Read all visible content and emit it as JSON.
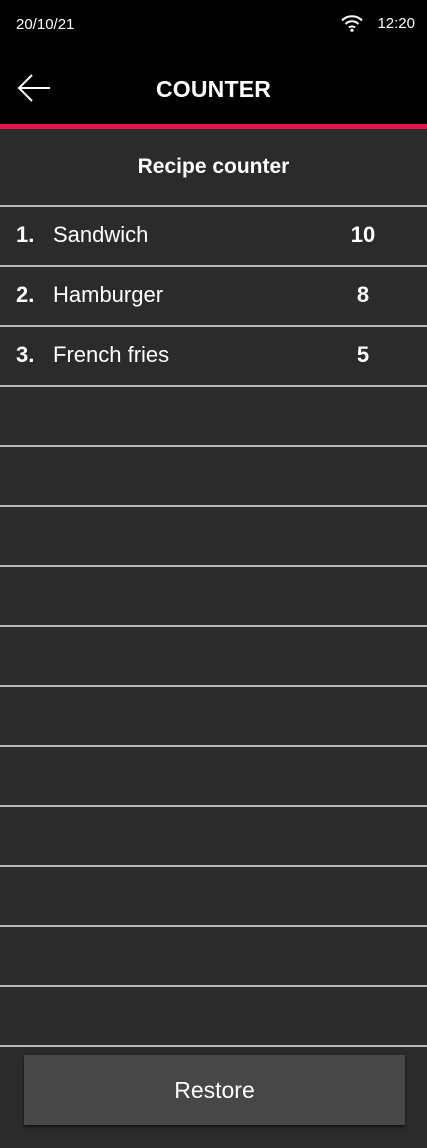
{
  "status_bar": {
    "date": "20/10/21",
    "time": "12:20",
    "wifi_icon": "wifi-icon"
  },
  "header": {
    "title": "COUNTER",
    "back_icon": "arrow-left-icon",
    "accent_color": "#e3154a"
  },
  "section": {
    "title": "Recipe counter"
  },
  "recipes": [
    {
      "num": "1.",
      "name": "Sandwich",
      "count": "10"
    },
    {
      "num": "2.",
      "name": "Hamburger",
      "count": "8"
    },
    {
      "num": "3.",
      "name": "French fries",
      "count": "5"
    },
    {
      "num": "",
      "name": "",
      "count": ""
    },
    {
      "num": "",
      "name": "",
      "count": ""
    },
    {
      "num": "",
      "name": "",
      "count": ""
    },
    {
      "num": "",
      "name": "",
      "count": ""
    },
    {
      "num": "",
      "name": "",
      "count": ""
    },
    {
      "num": "",
      "name": "",
      "count": ""
    },
    {
      "num": "",
      "name": "",
      "count": ""
    },
    {
      "num": "",
      "name": "",
      "count": ""
    },
    {
      "num": "",
      "name": "",
      "count": ""
    },
    {
      "num": "",
      "name": "",
      "count": ""
    },
    {
      "num": "",
      "name": "",
      "count": ""
    }
  ],
  "footer": {
    "restore_label": "Restore"
  }
}
